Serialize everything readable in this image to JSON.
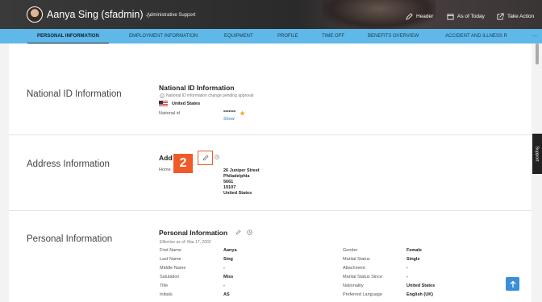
{
  "header": {
    "user_name": "Aanya Sing (sfadmin)",
    "role": "Administrative Support",
    "actions": [
      "Header",
      "As of Today",
      "Take Action"
    ]
  },
  "tabs": [
    "PERSONAL INFORMATION",
    "EMPLOYMENT INFORMATION",
    "EQUIPMENT",
    "PROFILE",
    "TIME OFF",
    "BENEFITS OVERVIEW",
    "ACCIDENT AND ILLNESS R",
    "..."
  ],
  "national_id": {
    "section_label": "National ID Information",
    "card_title": "National ID Information",
    "pending_note": "National ID information change pending approval",
    "country": "United States",
    "field_label": "National id",
    "field_value": "*******",
    "show_link": "Show"
  },
  "address": {
    "section_label": "Address Information",
    "card_title": "Add",
    "field_label": "Home",
    "lines": [
      "26 Juniper Street",
      "Philadelphia",
      "5661",
      "19107",
      "United States"
    ],
    "step_number": "2"
  },
  "personal": {
    "section_label": "Personal Information",
    "card_title": "Personal Information",
    "effective": "Effective as of: Mar 17, 2002",
    "left_fields": [
      {
        "label": "First Name",
        "value": "Aanya"
      },
      {
        "label": "Last Name",
        "value": "Sing"
      },
      {
        "label": "Middle Name",
        "value": "-"
      },
      {
        "label": "Salutation",
        "value": "Miss"
      },
      {
        "label": "Title",
        "value": "-"
      },
      {
        "label": "Initials",
        "value": "AS"
      }
    ],
    "right_fields": [
      {
        "label": "Gender",
        "value": "Female"
      },
      {
        "label": "Marital Status",
        "value": "Single"
      },
      {
        "label": "Attachment",
        "value": "-"
      },
      {
        "label": "Marital Status Since",
        "value": "-"
      },
      {
        "label": "Nationality",
        "value": "United States"
      },
      {
        "label": "Preferred Language",
        "value": "English (UK)"
      }
    ]
  },
  "support_label": "Support",
  "colors": {
    "tab_bar": "#5fb8e8",
    "step_badge": "#f05a28",
    "link": "#2a7ab8",
    "star": "#f5a623"
  }
}
